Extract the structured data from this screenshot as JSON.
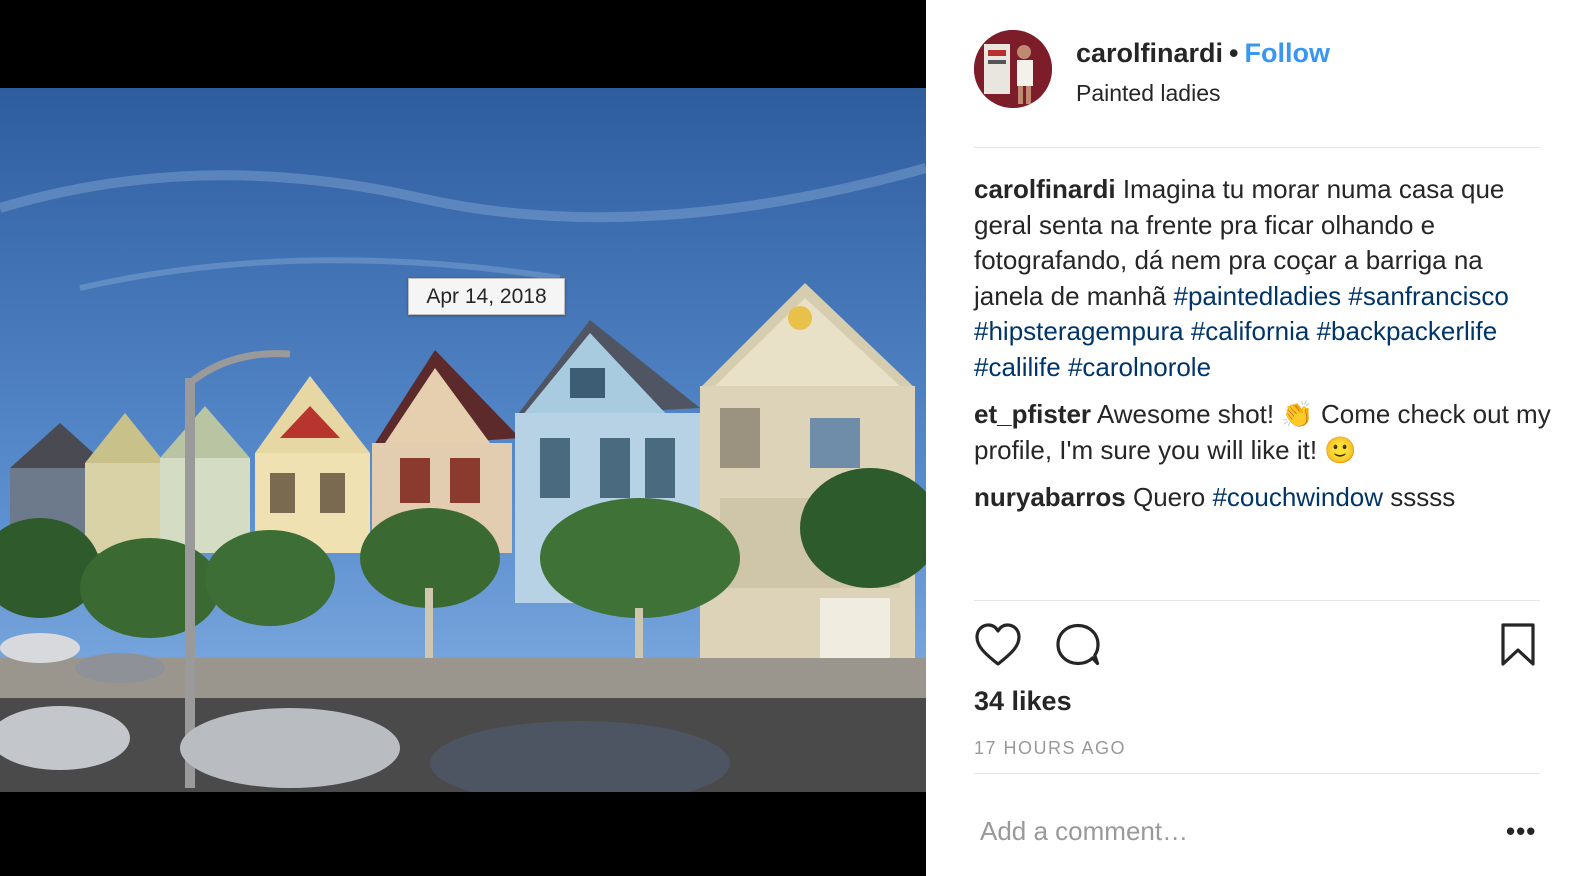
{
  "post": {
    "date_tooltip": "Apr 14, 2018",
    "username": "carolfinardi",
    "follow_label": "Follow",
    "location": "Painted ladies",
    "likes": "34 likes",
    "time": "17 HOURS AGO",
    "comment_placeholder": "Add a comment…",
    "more_label": "•••"
  },
  "comments": [
    {
      "author": "carolfinardi",
      "text": "Imagina tu morar numa casa que geral senta na frente pra ficar olhando e fotografando, dá nem pra coçar a barriga na janela de manhã ",
      "hashtags": [
        "#paintedladies",
        "#sanfrancisco",
        "#hipsteragempura",
        "#california",
        "#backpackerlife",
        "#calilife",
        "#carolnorole"
      ]
    },
    {
      "author": "et_pfister",
      "text_before": "Awesome shot! ",
      "emoji1": "👏",
      "text_after": " Come check out my profile, I'm sure you will like it! ",
      "emoji2": "🙂"
    },
    {
      "author": "nuryabarros",
      "text_before": "Quero ",
      "hashtag": "#couchwindow",
      "text_after": " sssss"
    }
  ],
  "icons": {
    "like": "heart-icon",
    "comment": "speech-bubble-icon",
    "save": "bookmark-icon"
  },
  "colors": {
    "follow": "#3897f0",
    "hashtag": "#003569",
    "muted": "#999999"
  }
}
